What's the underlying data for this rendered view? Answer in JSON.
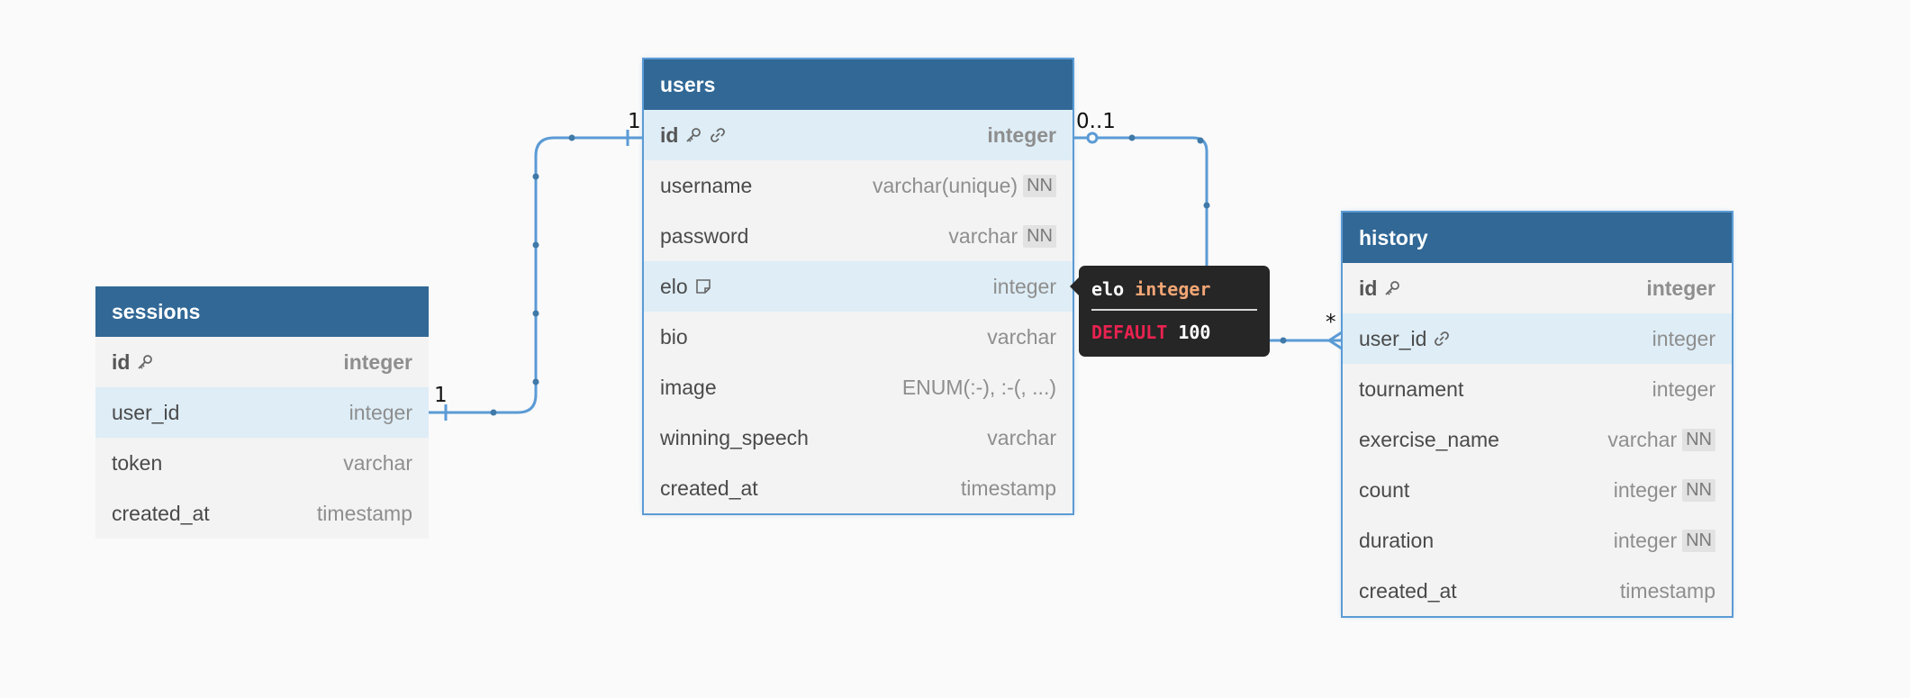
{
  "tables": {
    "sessions": {
      "title": "sessions",
      "fields": [
        {
          "name": "id",
          "type": "integer"
        },
        {
          "name": "user_id",
          "type": "integer"
        },
        {
          "name": "token",
          "type": "varchar"
        },
        {
          "name": "created_at",
          "type": "timestamp"
        }
      ]
    },
    "users": {
      "title": "users",
      "fields": [
        {
          "name": "id",
          "type": "integer"
        },
        {
          "name": "username",
          "type": "varchar(unique)",
          "badge": "NN"
        },
        {
          "name": "password",
          "type": "varchar",
          "badge": "NN"
        },
        {
          "name": "elo",
          "type": "integer"
        },
        {
          "name": "bio",
          "type": "varchar"
        },
        {
          "name": "image",
          "type": "ENUM(:-), :-(, ...)"
        },
        {
          "name": "winning_speech",
          "type": "varchar"
        },
        {
          "name": "created_at",
          "type": "timestamp"
        }
      ]
    },
    "history": {
      "title": "history",
      "fields": [
        {
          "name": "id",
          "type": "integer"
        },
        {
          "name": "user_id",
          "type": "integer"
        },
        {
          "name": "tournament",
          "type": "integer"
        },
        {
          "name": "exercise_name",
          "type": "varchar",
          "badge": "NN"
        },
        {
          "name": "count",
          "type": "integer",
          "badge": "NN"
        },
        {
          "name": "duration",
          "type": "integer",
          "badge": "NN"
        },
        {
          "name": "created_at",
          "type": "timestamp"
        }
      ]
    }
  },
  "relations": {
    "sessions_users": {
      "from_label": "1",
      "to_label": "1"
    },
    "users_history": {
      "from_label": "0..1",
      "to_label": "*"
    }
  },
  "tooltip": {
    "field": "elo",
    "type": "integer",
    "keyword": "DEFAULT",
    "value": "100"
  },
  "icons": {
    "primary_key": "key-icon",
    "foreign_key": "link-icon",
    "note": "note-icon"
  },
  "colors": {
    "header": "#316896",
    "highlight_row": "#deedf6",
    "relation_line": "#5b9bd5",
    "tooltip_bg": "#262626",
    "tooltip_type": "#f2a675",
    "tooltip_keyword": "#e8224f"
  }
}
